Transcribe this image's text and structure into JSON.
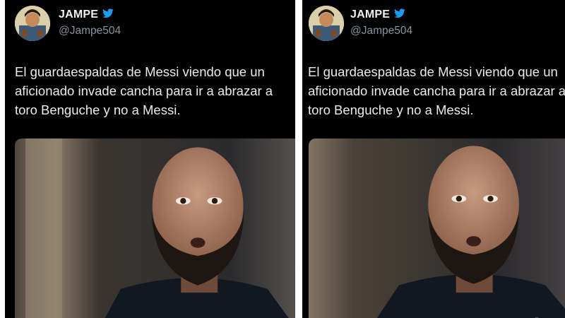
{
  "posts": [
    {
      "display_name": "JAMPE",
      "handle": "@Jampe504",
      "verified_icon": "twitter-bird-icon",
      "text_lines": [
        "El guardaespaldas de Messi viendo que un",
        "aficionado invade cancha para ir a abrazar a",
        "toro Benguche y no a Messi."
      ]
    },
    {
      "display_name": "JAMPE",
      "handle": "@Jampe504",
      "verified_icon": "twitter-bird-icon",
      "text_lines": [
        "El guardaespaldas de Messi viendo que un",
        "aficionado invade cancha para ir a abrazar a",
        "toro Benguche y no a Messi."
      ]
    }
  ],
  "colors": {
    "background": "#000000",
    "text": "#e7e9ea",
    "handle": "#8b9299",
    "divider": "#ffffff"
  }
}
